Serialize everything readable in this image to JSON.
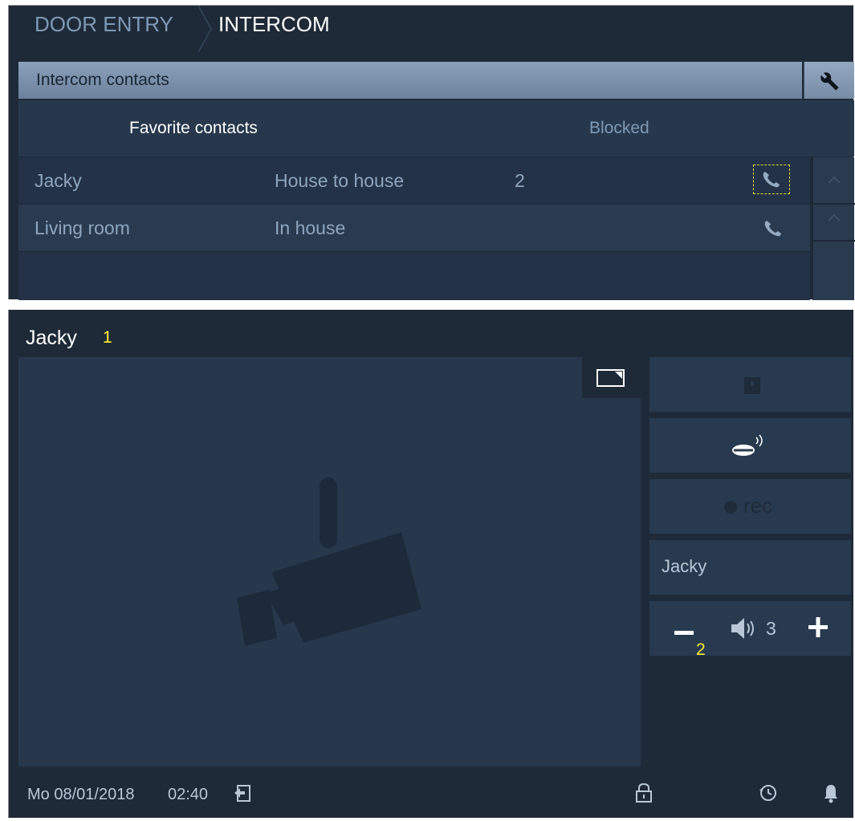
{
  "breadcrumb": {
    "section": "DOOR ENTRY",
    "page": "INTERCOM"
  },
  "contacts_bar": {
    "title": "Intercom contacts",
    "icon": "wrench-icon"
  },
  "tabs": {
    "favorite": "Favorite contacts",
    "blocked": "Blocked"
  },
  "contacts": [
    {
      "name": "Jacky",
      "type": "House to house",
      "number": "2",
      "icon": "phone-icon",
      "selected": true
    },
    {
      "name": "Living room",
      "type": "In house",
      "number": "",
      "icon": "phone-icon",
      "selected": false
    }
  ],
  "call": {
    "caller": "Jacky",
    "caller_marker": "1",
    "side_label": "Jacky",
    "rec_label": "rec",
    "volume_level": "3",
    "volume_marker": "2"
  },
  "status_bar": {
    "date": "Mo 08/01/2018",
    "time": "02:40"
  },
  "colors": {
    "panel": "#1f2a38",
    "accent_bar": "#7f95b0",
    "highlight": "#ffee33"
  }
}
